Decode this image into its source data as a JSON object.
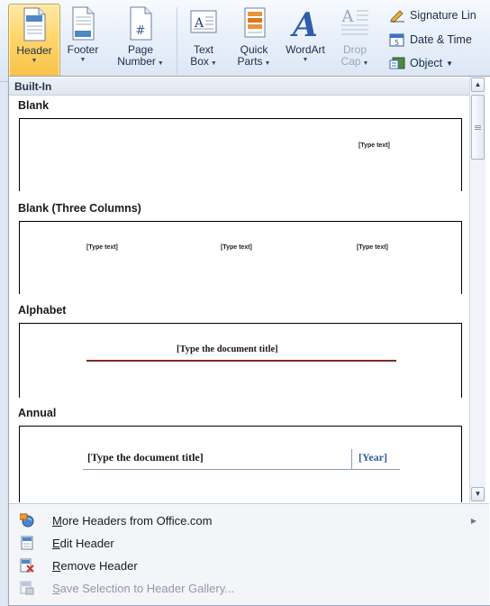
{
  "ribbon": {
    "header": {
      "label": "Header"
    },
    "footer": {
      "label": "Footer"
    },
    "page_number": {
      "label1": "Page",
      "label2": "Number"
    },
    "text_box": {
      "label1": "Text",
      "label2": "Box"
    },
    "quick_parts": {
      "label1": "Quick",
      "label2": "Parts"
    },
    "wordart": {
      "label": "WordArt"
    },
    "drop_cap": {
      "label1": "Drop",
      "label2": "Cap"
    },
    "signature_line": {
      "label": "Signature Lin"
    },
    "date_time": {
      "label": "Date & Time"
    },
    "object": {
      "label": "Object"
    }
  },
  "gallery": {
    "section_header": "Built-In",
    "items": [
      {
        "name": "Blank",
        "placeholder": "[Type text]"
      },
      {
        "name": "Blank (Three Columns)",
        "placeholders": [
          "[Type text]",
          "[Type text]",
          "[Type text]"
        ]
      },
      {
        "name": "Alphabet",
        "title": "[Type the document title]"
      },
      {
        "name": "Annual",
        "title": "[Type the document title]",
        "year": "[Year]"
      }
    ]
  },
  "menu": {
    "more_headers": {
      "first": "M",
      "rest": "ore Headers from Office.com"
    },
    "edit_header": {
      "first": "E",
      "rest": "dit Header"
    },
    "remove_header": {
      "first": "R",
      "rest": "emove Header"
    },
    "save_selection": {
      "first": "S",
      "rest": "ave Selection to Header Gallery..."
    }
  },
  "colors": {
    "active_button": "#ffd66b",
    "alphabet_rule": "#7a2b2b",
    "annual_year": "#2e5e9e"
  }
}
